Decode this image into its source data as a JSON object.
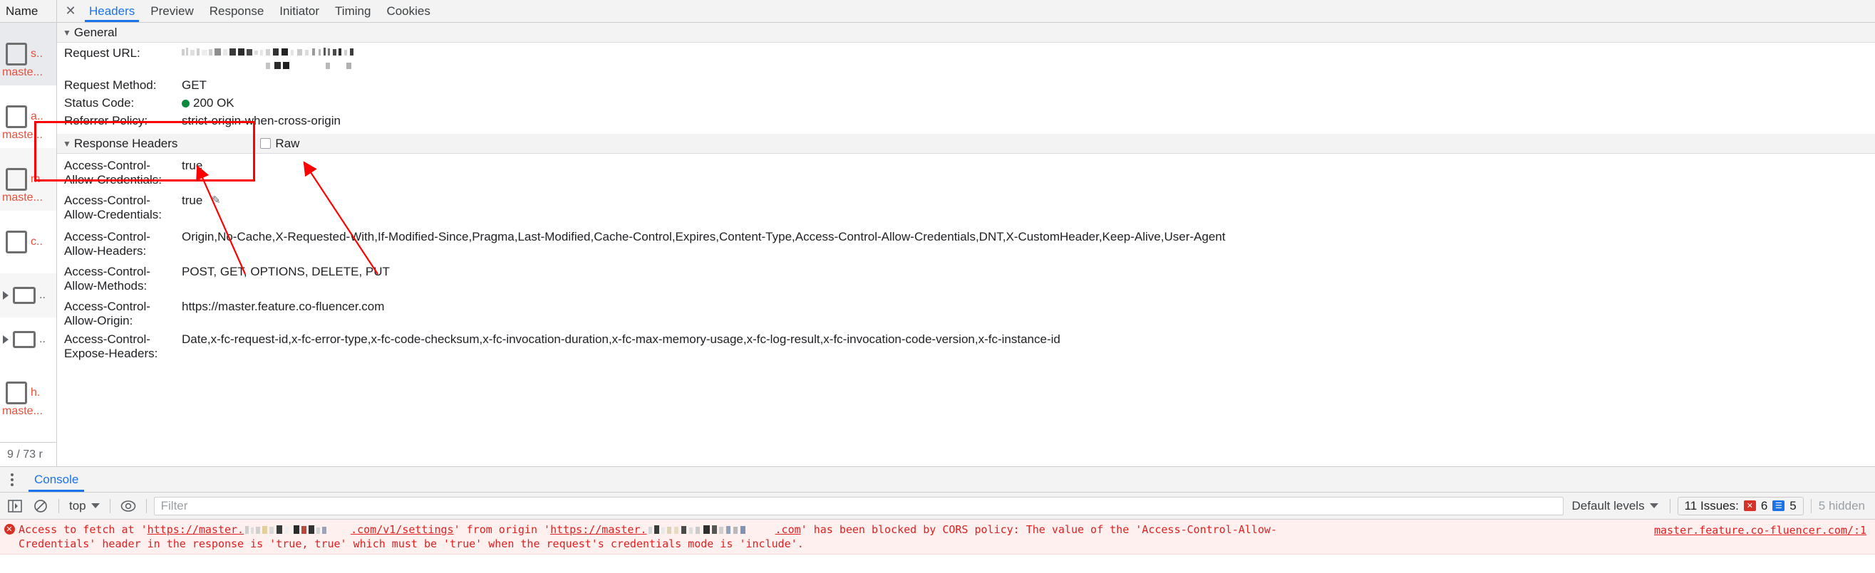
{
  "request_list": {
    "column_header": "Name",
    "footer": "9 / 73 r",
    "items": [
      {
        "type": "doc",
        "name": "s..",
        "sub": "maste...",
        "selected": true
      },
      {
        "type": "doc",
        "name": "a..",
        "sub": "maste...",
        "selected": false
      },
      {
        "type": "doc",
        "name": "m",
        "sub": "maste...",
        "selected": false
      },
      {
        "type": "doc",
        "name": "c..",
        "sub": "",
        "selected": false
      },
      {
        "type": "folder",
        "name": "..",
        "sub": "",
        "selected": false
      },
      {
        "type": "folder",
        "name": "..",
        "sub": "",
        "selected": false
      },
      {
        "type": "doc",
        "name": "h.",
        "sub": "maste...",
        "selected": false
      }
    ]
  },
  "detail": {
    "close_label": "✕",
    "tabs": [
      {
        "label": "Headers",
        "active": true
      },
      {
        "label": "Preview",
        "active": false
      },
      {
        "label": "Response",
        "active": false
      },
      {
        "label": "Initiator",
        "active": false
      },
      {
        "label": "Timing",
        "active": false
      },
      {
        "label": "Cookies",
        "active": false
      }
    ],
    "general": {
      "section_title": "General",
      "rows": [
        {
          "key": "Request URL:",
          "value": "",
          "redacted": true
        },
        {
          "key": "Request Method:",
          "value": "GET"
        },
        {
          "key": "Status Code:",
          "value": "200 OK",
          "status_dot": "#0c8a3e"
        },
        {
          "key": "Referrer Policy:",
          "value": "strict-origin-when-cross-origin"
        }
      ]
    },
    "response_headers": {
      "section_title": "Response Headers",
      "raw_label": "Raw",
      "highlighted_rows": [
        {
          "key": "Access-Control-Allow-Credentials:",
          "value": "true",
          "pencil": false
        },
        {
          "key": "Access-Control-Allow-Credentials:",
          "value": "true",
          "pencil": true
        }
      ],
      "rows": [
        {
          "key": "Access-Control-Allow-Headers:",
          "value": "Origin,No-Cache,X-Requested-With,If-Modified-Since,Pragma,Last-Modified,Cache-Control,Expires,Content-Type,Access-Control-Allow-Credentials,DNT,X-CustomHeader,Keep-Alive,User-Agent"
        },
        {
          "key": "Access-Control-Allow-Methods:",
          "value": "POST, GET, OPTIONS, DELETE, PUT"
        },
        {
          "key": "Access-Control-Allow-Origin:",
          "value": "https://master.feature.co-fluencer.com"
        },
        {
          "key": "Access-Control-Expose-Headers:",
          "value": "Date,x-fc-request-id,x-fc-error-type,x-fc-code-checksum,x-fc-invocation-duration,x-fc-max-memory-usage,x-fc-log-result,x-fc-invocation-code-version,x-fc-instance-id"
        }
      ]
    }
  },
  "drawer": {
    "tabs": [
      {
        "label": "Console",
        "active": true
      }
    ],
    "toolbar": {
      "sidebar_icon": "show-console-sidebar-icon",
      "clear_icon": "clear-console-icon",
      "context": "top",
      "eye_icon": "live-expression-icon",
      "filter_placeholder": "Filter",
      "levels": "Default levels",
      "issues_label": "11 Issues:",
      "issues_errors": "6",
      "issues_info": "5",
      "hidden": "5 hidden"
    },
    "messages": [
      {
        "icon": "error-icon",
        "line1_a": "Access to fetch at '",
        "line1_url1": "https://master.",
        "line1_url1b": ".com/v1/settings",
        "line1_b": "' from origin '",
        "line1_url2": "https://master.",
        "line1_url2b": ".com",
        "line1_c": "' has been blocked by CORS policy: The value of the 'Access-Control-Allow-",
        "line2": "Credentials' header in the response is 'true, true' which must be 'true' when the request's credentials mode is 'include'.",
        "source": "master.feature.co-fluencer.com/:1"
      }
    ]
  },
  "colors": {
    "accent": "#1a73e8",
    "error": "#d93025",
    "success": "#0c8a3e",
    "highlight_box": "#ff0000",
    "request_name": "#e8503a"
  }
}
